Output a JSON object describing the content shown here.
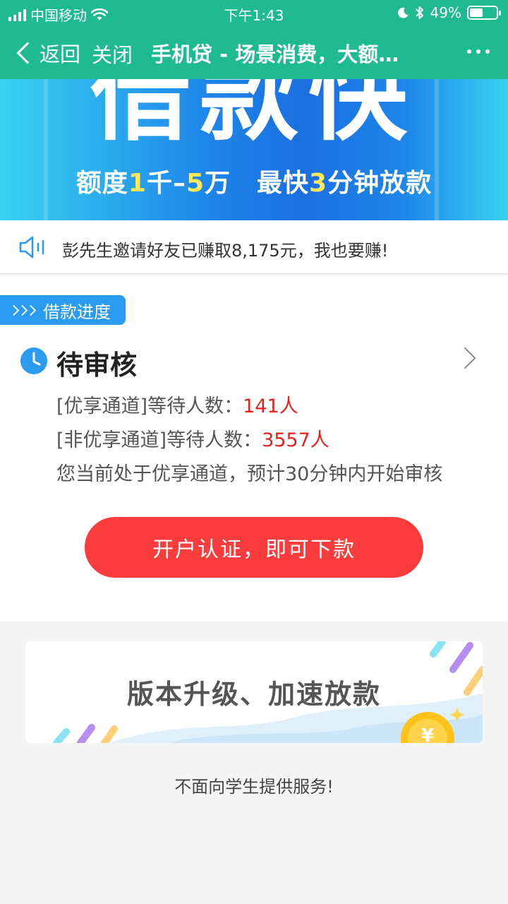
{
  "status_bar": {
    "carrier": "中国移动",
    "time": "下午1:43",
    "battery_text": "49%",
    "battery_level": 0.49
  },
  "nav": {
    "back_label": "返回",
    "close_label": "关闭",
    "title": "手机贷 - 场景消费，大额…"
  },
  "banner": {
    "headline": "借款快",
    "sub_a": "额度",
    "sub_hl1": "1",
    "sub_b": "千–",
    "sub_hl2": "5",
    "sub_c": "万　最快",
    "sub_hl3": "3",
    "sub_d": "分钟放款"
  },
  "notice": {
    "text": "彭先生邀请好友已赚取8,175元，我也要赚!"
  },
  "progress": {
    "tag_label": "借款进度",
    "status_title": "待审核",
    "line1_label": "[优享通道]等待人数：",
    "line1_value": "141人",
    "line2_label": "[非优享通道]等待人数：",
    "line2_value": "3557人",
    "line3": "您当前处于优享通道，预计30分钟内开始审核",
    "cta_label": "开户认证，即可下款"
  },
  "promo": {
    "text": "版本升级、加速放款"
  },
  "footer": {
    "note": "不面向学生提供服务!"
  },
  "colors": {
    "brand_green": "#1fb992",
    "accent_blue": "#2b9bf0",
    "cta_red": "#fb3c3c",
    "value_red": "#e6221b",
    "highlight_yellow": "#ffe75a"
  }
}
